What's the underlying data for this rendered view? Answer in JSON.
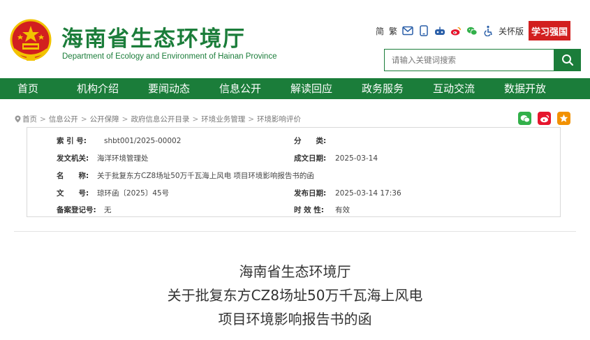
{
  "header": {
    "title": "海南省生态环境厅",
    "subtitle": "Department of Ecology and Environment of Hainan Province",
    "tools": {
      "simplified": "简",
      "traditional": "繁",
      "care_mode": "关怀版",
      "xuexi": "学习强国"
    },
    "search_placeholder": "请输入关键词搜索"
  },
  "nav": {
    "items": [
      "首页",
      "机构介绍",
      "要闻动态",
      "信息公开",
      "解读回应",
      "政务服务",
      "互动交流",
      "数据开放"
    ]
  },
  "breadcrumb": [
    "首页",
    "信息公开",
    "公开保障",
    "政府信息公开目录",
    "环境业务管理",
    "环境影响评价"
  ],
  "info": {
    "index_label": "索 引 号:",
    "index_value": "shbt001/2025-00002",
    "category_label": "分　　类:",
    "category_value": "",
    "issuer_label": "发文机关:",
    "issuer_value": "海洋环境管理处",
    "date_label": "成文日期:",
    "date_value": "2025-03-14",
    "name_label": "名　　称:",
    "name_value": "关于批复东方CZ8场址50万千瓦海上风电 项目环境影响报告书的函",
    "docno_label": "文　　号:",
    "docno_value": "琼环函〔2025〕45号",
    "pubdate_label": "发布日期:",
    "pubdate_value": "2025-03-14 17:36",
    "record_label": "备案登记号:",
    "record_value": "无",
    "validity_label": "时 效 性:",
    "validity_value": "有效"
  },
  "document": {
    "title_lines": [
      "海南省生态环境厅",
      "关于批复东方CZ8场址50万千瓦海上风电",
      "项目环境影响报告书的函"
    ]
  },
  "colors": {
    "brand_green": "#1b7d3a",
    "emblem_red": "#d21f1f",
    "gold": "#f2c200"
  }
}
